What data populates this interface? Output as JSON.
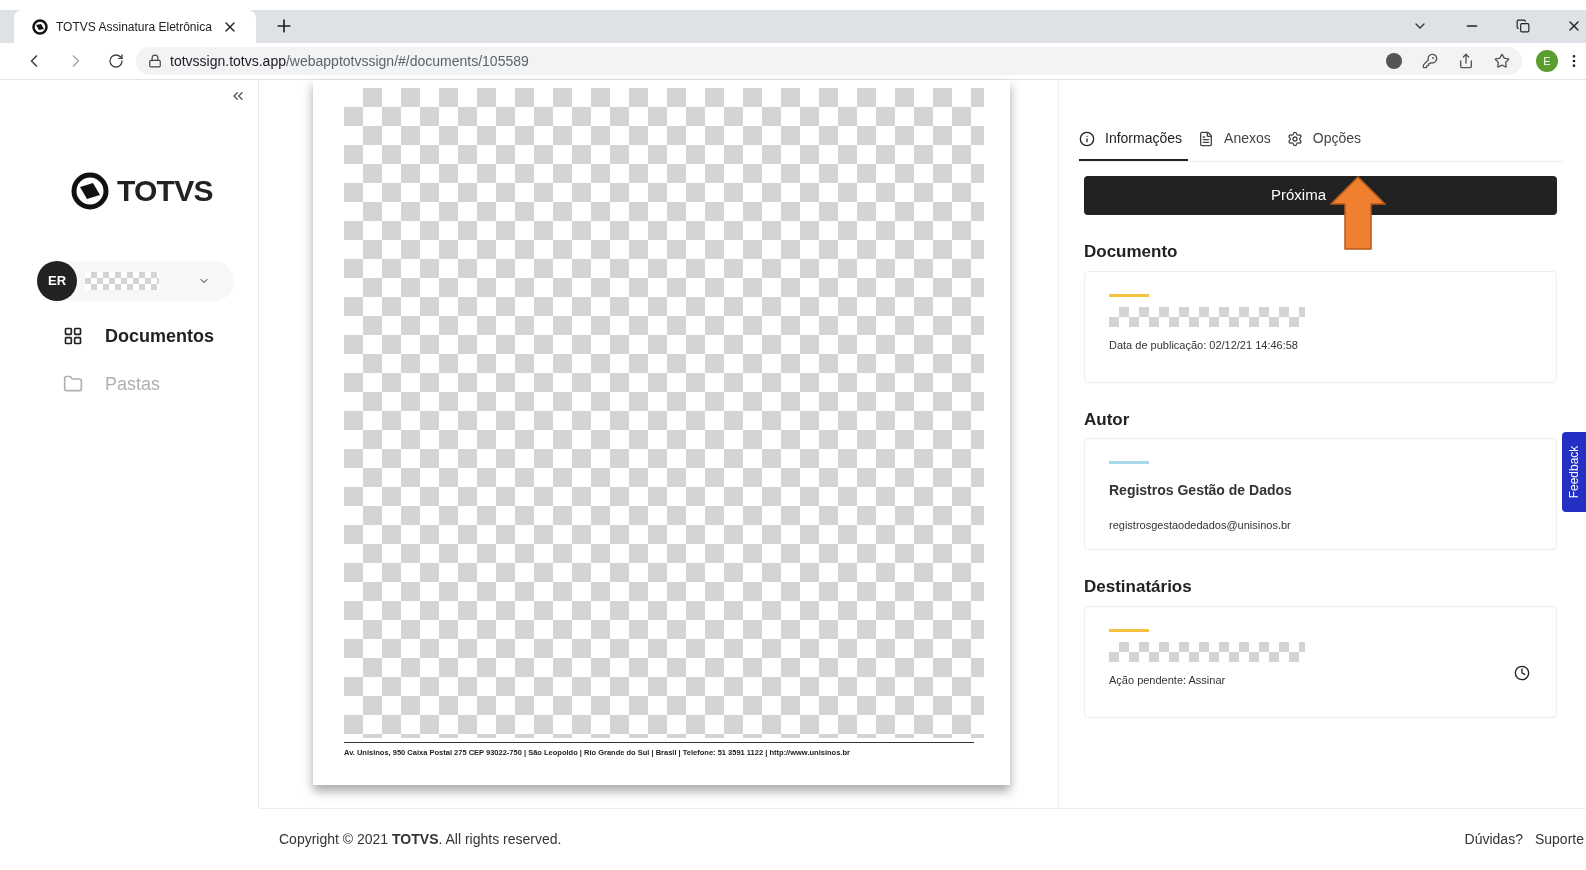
{
  "browser": {
    "tab_title": "TOTVS Assinatura Eletrônica",
    "url_host": "totvssign.totvs.app",
    "url_path": "/webapptotvssign/#/documents/105589",
    "profile_initial": "E"
  },
  "sidebar": {
    "logo_text": "TOTVS",
    "user_initials": "ER",
    "nav": [
      {
        "label": "Documentos",
        "selected": true,
        "kind": "grid"
      },
      {
        "label": "Pastas",
        "selected": false,
        "kind": "folder"
      }
    ]
  },
  "document": {
    "footer_address": "Av. Unisinos, 950 Caixa Postal 275  CEP 93022-750  | São Leopoldo | Rio Grande do Sul | Brasil | Telefone: 51 3591 1122 | http://www.unisinos.br"
  },
  "panel": {
    "tabs": [
      {
        "label": "Informações",
        "selected": true,
        "kind": "info"
      },
      {
        "label": "Anexos",
        "selected": false,
        "kind": "file"
      },
      {
        "label": "Opções",
        "selected": false,
        "kind": "gear"
      }
    ],
    "primary_button": "Próxima",
    "sections": [
      {
        "title": "Documento",
        "color": "#f5c242",
        "lines": [
          {
            "kind": "redacted"
          },
          {
            "kind": "small",
            "text": "Data de publicação: 02/12/21 14:46:58"
          }
        ],
        "pending": false
      },
      {
        "title": "Autor",
        "color": "#a8d8ea",
        "lines": [
          {
            "kind": "strong",
            "text": "Registros Gestão de Dados"
          },
          {
            "kind": "small",
            "text": "registrosgestaodedados@unisinos.br"
          }
        ],
        "pending": false
      },
      {
        "title": "Destinatários",
        "color": "#f5c242",
        "lines": [
          {
            "kind": "redacted"
          },
          {
            "kind": "small",
            "text": "Ação pendente: Assinar"
          }
        ],
        "pending": true
      }
    ]
  },
  "feedback_tab": "Feedback",
  "footer": {
    "copyright_prefix": "Copyright © 2021 ",
    "brand": "TOTVS",
    "copyright_suffix": ". All rights reserved.",
    "links": [
      "Dúvidas?",
      "Suporte"
    ]
  }
}
